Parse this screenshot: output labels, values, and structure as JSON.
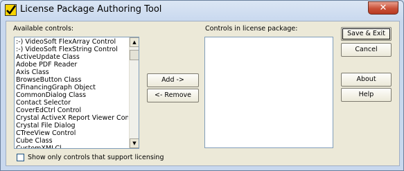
{
  "window": {
    "title": "License Package Authoring Tool",
    "close_glyph": "✕"
  },
  "available": {
    "label": "Available controls:",
    "items": [
      ":-) VideoSoft FlexArray Control",
      ":-) VideoSoft FlexString Control",
      "ActiveUpdate Class",
      "Adobe PDF Reader",
      "Axis Class",
      "BrowseButton Class",
      "CFinancingGraph Object",
      "CommonDialog Class",
      "Contact Selector",
      "CoverEdCtrl Control",
      "Crystal ActiveX Report Viewer Con",
      "Crystal File Dialog",
      "CTreeView Control",
      "Cube Class",
      "CustomXMLCl"
    ],
    "scroll_up_glyph": "▲",
    "scroll_down_glyph": "▼"
  },
  "package": {
    "label": "Controls in license package:",
    "items": []
  },
  "buttons": {
    "add": "Add ->",
    "remove": "<- Remove",
    "save_exit": "Save & Exit",
    "cancel": "Cancel",
    "about": "About",
    "help": "Help"
  },
  "checkbox": {
    "label": "Show only controls that support licensing",
    "checked": false
  }
}
